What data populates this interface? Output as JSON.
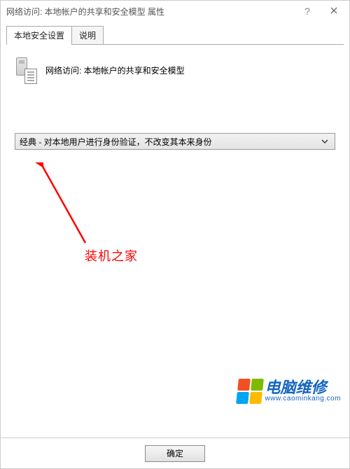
{
  "window": {
    "title": "网络访问: 本地帐户的共享和安全模型 属性",
    "help_label": "?",
    "close_label": "×"
  },
  "tabs": [
    {
      "label": "本地安全设置",
      "active": true
    },
    {
      "label": "说明",
      "active": false
    }
  ],
  "policy": {
    "heading": "网络访问: 本地帐户的共享和安全模型",
    "selected_value": "经典 - 对本地用户进行身份验证，不改变其本来身份"
  },
  "annotation": {
    "text": "装机之家"
  },
  "buttons": {
    "ok": "确定"
  },
  "watermark": {
    "brand": "电脑维修",
    "url": "www.caominkang.com"
  },
  "icons": {
    "help": "help-icon",
    "close": "close-icon",
    "chevron_down": "chevron-down-icon",
    "policy": "policy-icon",
    "windows_flag": "windows-flag-icon"
  }
}
